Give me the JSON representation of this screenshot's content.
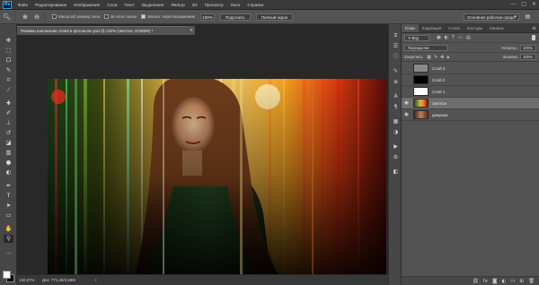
{
  "app": {
    "logo": "Ps"
  },
  "menu": [
    "Файл",
    "Редактирование",
    "Изображение",
    "Слои",
    "Текст",
    "Выделение",
    "Фильтр",
    "3D",
    "Просмотр",
    "Окно",
    "Справка"
  ],
  "window_controls": {
    "minimize": "—",
    "maximize": "□",
    "close": "✕"
  },
  "options": {
    "zoom_icon": "zoom-icon",
    "checkboxes": [
      {
        "label": "Масштаб размер окна",
        "checked": false
      },
      {
        "label": "Во всех окнах",
        "checked": false
      },
      {
        "label": "Масшт. перетаскиванием",
        "checked": true
      }
    ],
    "zoom_value": "100%",
    "fit_button": "Подогнать",
    "fill_button": "Полный экран",
    "workspace": "Основная рабочая среда"
  },
  "document": {
    "tab_title": "Режимы наложения слоев в фотошопе.psd @ 132% (светлое, RGB/8#) *",
    "status_zoom": "132,67%",
    "status_doc": "Док: 771,4К/2,58М",
    "status_arrow": "›"
  },
  "panel": {
    "tabs": [
      "Слои",
      "Коррекция",
      "Стили",
      "Контуры",
      "Каналы"
    ],
    "active_tab": 0,
    "filter_kind": "Вид",
    "blend_mode": "Перекрытие",
    "opacity_label": "Непрозр.:",
    "opacity_value": "100%",
    "lock_label": "Закрепить:",
    "fill_label": "Заливка:",
    "fill_value": "100%",
    "layers": [
      {
        "name": "Слой 3",
        "visible": false,
        "selected": false,
        "thumb": "gray"
      },
      {
        "name": "Слой 2",
        "visible": false,
        "selected": false,
        "thumb": "black"
      },
      {
        "name": "Слой 1",
        "visible": false,
        "selected": false,
        "thumb": "white"
      },
      {
        "name": "светлое",
        "visible": true,
        "selected": true,
        "thumb": "photo"
      },
      {
        "name": "девушка",
        "visible": true,
        "selected": false,
        "thumb": "photo-warm"
      }
    ]
  },
  "colors": {
    "accent": "#2fa3f0",
    "panel_bg": "#535353",
    "selected_layer": "#6e6e6e",
    "foreground": "#ffffff",
    "background": "#000000"
  }
}
